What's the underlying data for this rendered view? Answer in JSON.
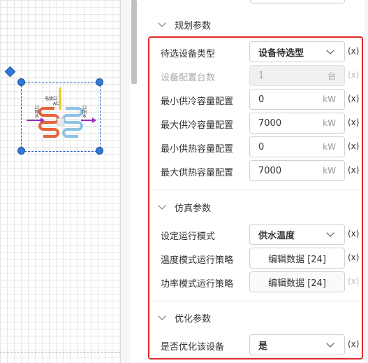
{
  "colors": {
    "highlight": "#e32828",
    "handle": "#2f7ad8",
    "pipe_hot": "#e8643c",
    "pipe_cold": "#8ec3e6",
    "flow_arrow": "#9b2fc0",
    "power_line": "#e8c61a"
  },
  "canvas": {
    "device": {
      "icon": "heat-pump-icon",
      "label_top": "电接口",
      "label_top2": "AC",
      "label_left": "口",
      "label_left2": "网",
      "label_left3": "水",
      "label_right": "口",
      "label_right2": "阳",
      "label_right3": "水"
    }
  },
  "sections": {
    "planning": {
      "title": "规划参数",
      "rows": {
        "device_type": {
          "label": "待选设备类型",
          "value": "设备待选型",
          "x": "(x)"
        },
        "device_count": {
          "label": "设备配置台数",
          "value": "1",
          "unit": "台",
          "x": "(x)"
        },
        "min_cool": {
          "label": "最小供冷容量配置",
          "value": "0",
          "unit": "kW",
          "x": "(x)"
        },
        "max_cool": {
          "label": "最大供冷容量配置",
          "value": "7000",
          "unit": "kW",
          "x": "(x)"
        },
        "min_heat": {
          "label": "最小供热容量配置",
          "value": "0",
          "unit": "kW",
          "x": "(x)"
        },
        "max_heat": {
          "label": "最大供热容量配置",
          "value": "7000",
          "unit": "kW",
          "x": "(x)"
        }
      }
    },
    "simulation": {
      "title": "仿真参数",
      "rows": {
        "run_mode": {
          "label": "设定运行模式",
          "value": "供水温度",
          "x": "(x)"
        },
        "temp_strategy": {
          "label": "温度模式运行策略",
          "value": "编辑数据 [24]",
          "x": "(x)"
        },
        "power_strategy": {
          "label": "功率模式运行策略",
          "value": "编辑数据 [24]",
          "x": "(x)"
        }
      }
    },
    "optimization": {
      "title": "优化参数",
      "rows": {
        "optimize": {
          "label": "是否优化该设备",
          "value": "是",
          "x": "(x)"
        }
      }
    }
  }
}
